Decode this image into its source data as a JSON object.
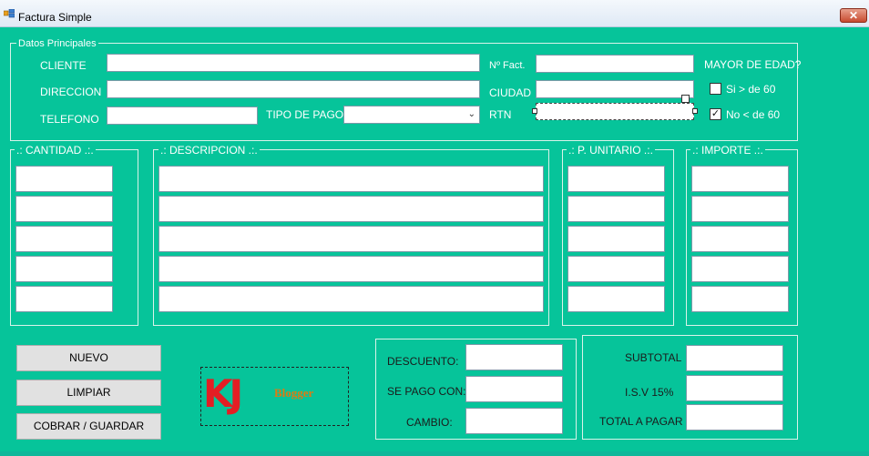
{
  "window": {
    "title": "Factura Simple",
    "close_label": "✕"
  },
  "datos": {
    "legend": "Datos Principales",
    "cliente_label": "CLIENTE",
    "direccion_label": "DIRECCION",
    "telefono_label": "TELEFONO",
    "tipo_pago_label": "TIPO DE PAGO",
    "tipo_pago_value": "",
    "nfact_label": "Nº Fact.",
    "ciudad_label": "CIUDAD",
    "rtn_label": "RTN",
    "mayor_label": "MAYOR DE EDAD?",
    "si_label": "Si > de 60",
    "no_label": "No < de 60",
    "si_checked": false,
    "no_checked": true
  },
  "columns": {
    "cantidad": ".: CANTIDAD .:.",
    "descripcion": ".: DESCRIPCION .:.",
    "p_unitario": ".: P. UNITARIO .:.",
    "importe": ".: IMPORTE .:."
  },
  "buttons": {
    "nuevo": "NUEVO",
    "limpiar": "LIMPIAR",
    "cobrar": "COBRAR / GUARDAR"
  },
  "logo": {
    "text": "KJ",
    "sub": "Blogger"
  },
  "payment": {
    "descuento": "DESCUENTO:",
    "se_pago_con": "SE PAGO CON:",
    "cambio": "CAMBIO:"
  },
  "totals": {
    "subtotal": "SUBTOTAL",
    "isv": "I.S.V 15%",
    "total": "TOTAL A PAGAR"
  },
  "colors": {
    "background": "#06c49a",
    "logo_red": "#e31e24",
    "logo_orange": "#e07a10"
  }
}
